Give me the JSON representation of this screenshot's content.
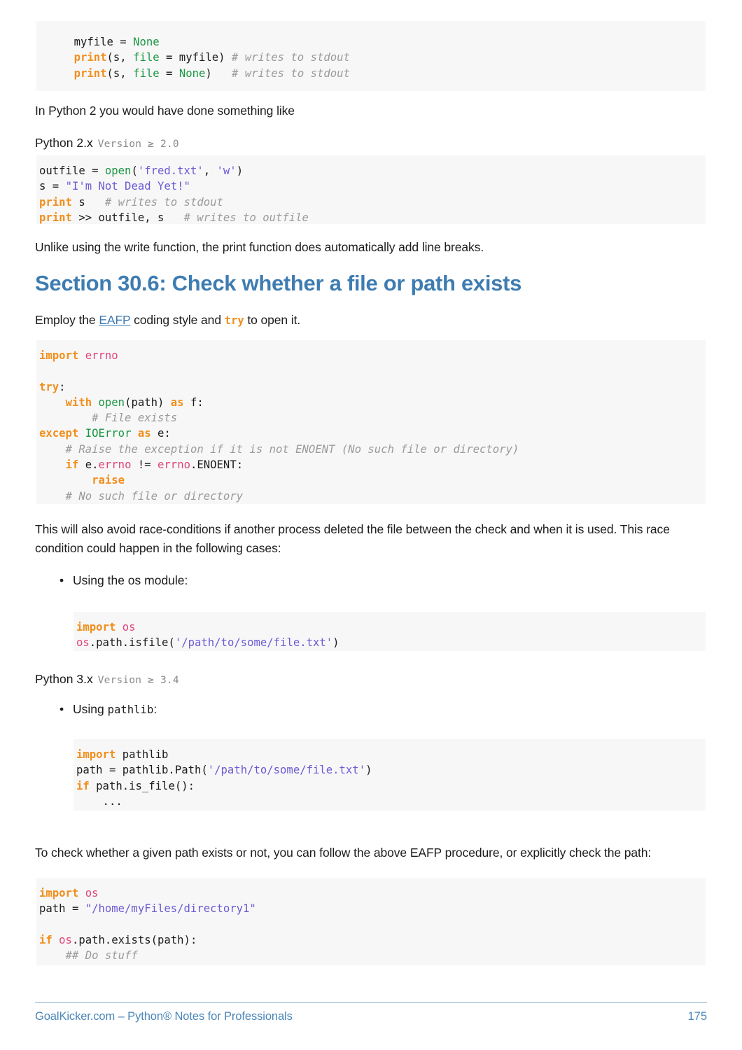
{
  "document": {
    "page_number": "175",
    "footer_text": "GoalKicker.com – Python® Notes for Professionals",
    "accent_color": "#3e7cb1",
    "code_bg_color": "#f7f7f8"
  },
  "code_block_1": {
    "lines": [
      [
        {
          "t": "    ",
          "c": "pl"
        },
        {
          "t": "myfile ",
          "c": "pl"
        },
        {
          "t": "= ",
          "c": "pl"
        },
        {
          "t": "None",
          "c": "bi"
        }
      ],
      [
        {
          "t": "    ",
          "c": "pl"
        },
        {
          "t": "print",
          "c": "kw"
        },
        {
          "t": "(s, ",
          "c": "pl"
        },
        {
          "t": "file",
          "c": "bi"
        },
        {
          "t": " = myfile) ",
          "c": "pl"
        },
        {
          "t": "# writes to stdout",
          "c": "cmt"
        }
      ],
      [
        {
          "t": "    ",
          "c": "pl"
        },
        {
          "t": "print",
          "c": "kw"
        },
        {
          "t": "(s, ",
          "c": "pl"
        },
        {
          "t": "file",
          "c": "bi"
        },
        {
          "t": " = ",
          "c": "pl"
        },
        {
          "t": "None",
          "c": "bi"
        },
        {
          "t": ")   ",
          "c": "pl"
        },
        {
          "t": "# writes to stdout",
          "c": "cmt"
        }
      ]
    ]
  },
  "para_1": "In Python 2 you would have done something like",
  "version_2x": {
    "name": "Python 2.x",
    "version": "Version ≥ 2.0"
  },
  "code_block_2": {
    "lines": [
      [
        {
          "t": "outfile = ",
          "c": "pl"
        },
        {
          "t": "open",
          "c": "bi"
        },
        {
          "t": "(",
          "c": "pl"
        },
        {
          "t": "'fred.txt'",
          "c": "str"
        },
        {
          "t": ", ",
          "c": "pl"
        },
        {
          "t": "'w'",
          "c": "str"
        },
        {
          "t": ")",
          "c": "pl"
        }
      ],
      [
        {
          "t": "s = ",
          "c": "pl"
        },
        {
          "t": "\"I'm Not Dead Yet!\"",
          "c": "str"
        }
      ],
      [
        {
          "t": "print",
          "c": "kw"
        },
        {
          "t": " s   ",
          "c": "pl"
        },
        {
          "t": "# writes to stdout",
          "c": "cmt"
        }
      ],
      [
        {
          "t": "print",
          "c": "kw"
        },
        {
          "t": " >> outfile, s   ",
          "c": "pl"
        },
        {
          "t": "# writes to outfile",
          "c": "cmt"
        }
      ]
    ]
  },
  "para_2": "Unlike using the write function, the print function does automatically add line breaks.",
  "section_heading": "Section 30.6: Check whether a file or path exists",
  "para_3": {
    "before_link": "Employ the ",
    "link": "EAFP",
    "middle": " coding style and ",
    "code": "try",
    "after": " to open it."
  },
  "code_block_3": {
    "lines": [
      [
        {
          "t": "import",
          "c": "kw"
        },
        {
          "t": " ",
          "c": "pl"
        },
        {
          "t": "errno",
          "c": "mod"
        }
      ],
      [
        {
          "t": "",
          "c": "pl"
        }
      ],
      [
        {
          "t": "try",
          "c": "kw"
        },
        {
          "t": ":",
          "c": "pl"
        }
      ],
      [
        {
          "t": "    ",
          "c": "pl"
        },
        {
          "t": "with",
          "c": "kw"
        },
        {
          "t": " ",
          "c": "pl"
        },
        {
          "t": "open",
          "c": "bi"
        },
        {
          "t": "(path) ",
          "c": "pl"
        },
        {
          "t": "as",
          "c": "kw"
        },
        {
          "t": " f:",
          "c": "pl"
        }
      ],
      [
        {
          "t": "        ",
          "c": "pl"
        },
        {
          "t": "# File exists",
          "c": "cmt"
        }
      ],
      [
        {
          "t": "except",
          "c": "kw"
        },
        {
          "t": " ",
          "c": "pl"
        },
        {
          "t": "IOError",
          "c": "bi"
        },
        {
          "t": " ",
          "c": "pl"
        },
        {
          "t": "as",
          "c": "kw"
        },
        {
          "t": " e:",
          "c": "pl"
        }
      ],
      [
        {
          "t": "    ",
          "c": "pl"
        },
        {
          "t": "# Raise the exception if it is not ENOENT (No such file or directory)",
          "c": "cmt"
        }
      ],
      [
        {
          "t": "    ",
          "c": "pl"
        },
        {
          "t": "if",
          "c": "kw"
        },
        {
          "t": " e.",
          "c": "pl"
        },
        {
          "t": "errno",
          "c": "mod"
        },
        {
          "t": " != ",
          "c": "pl"
        },
        {
          "t": "errno",
          "c": "mod"
        },
        {
          "t": ".ENOENT:",
          "c": "pl"
        }
      ],
      [
        {
          "t": "        ",
          "c": "pl"
        },
        {
          "t": "raise",
          "c": "kw"
        }
      ],
      [
        {
          "t": "    ",
          "c": "pl"
        },
        {
          "t": "# No such file or directory",
          "c": "cmt"
        }
      ]
    ]
  },
  "para_4": "This will also avoid race-conditions if another process deleted the file between the check and when it is used. This race condition could happen in the following cases:",
  "bullet_1": {
    "before": "Using the os module:",
    "marker": "•"
  },
  "code_block_4": {
    "lines": [
      [
        {
          "t": "import",
          "c": "kw"
        },
        {
          "t": " ",
          "c": "pl"
        },
        {
          "t": "os",
          "c": "mod"
        }
      ],
      [
        {
          "t": "os",
          "c": "mod"
        },
        {
          "t": ".path.isfile(",
          "c": "pl"
        },
        {
          "t": "'/path/to/some/file.txt'",
          "c": "str"
        },
        {
          "t": ")",
          "c": "pl"
        }
      ]
    ]
  },
  "version_3x": {
    "name": "Python 3.x",
    "version": "Version ≥ 3.4"
  },
  "bullet_2": {
    "marker": "•",
    "prefix": "Using ",
    "code": "pathlib",
    "suffix": ":"
  },
  "code_block_5": {
    "lines": [
      [
        {
          "t": "import",
          "c": "kw"
        },
        {
          "t": " pathlib",
          "c": "pl"
        }
      ],
      [
        {
          "t": "path = pathlib.Path(",
          "c": "pl"
        },
        {
          "t": "'/path/to/some/file.txt'",
          "c": "str"
        },
        {
          "t": ")",
          "c": "pl"
        }
      ],
      [
        {
          "t": "if",
          "c": "kw"
        },
        {
          "t": " path.is_file():",
          "c": "pl"
        }
      ],
      [
        {
          "t": "    ...",
          "c": "pl"
        }
      ]
    ]
  },
  "para_5": "To check whether a given path exists or not, you can follow the above EAFP procedure, or explicitly check the path:",
  "code_block_6": {
    "lines": [
      [
        {
          "t": "import",
          "c": "kw"
        },
        {
          "t": " ",
          "c": "pl"
        },
        {
          "t": "os",
          "c": "mod"
        }
      ],
      [
        {
          "t": "path = ",
          "c": "pl"
        },
        {
          "t": "\"/home/myFiles/directory1\"",
          "c": "str"
        }
      ],
      [
        {
          "t": "",
          "c": "pl"
        }
      ],
      [
        {
          "t": "if",
          "c": "kw"
        },
        {
          "t": " ",
          "c": "pl"
        },
        {
          "t": "os",
          "c": "mod"
        },
        {
          "t": ".path.exists(path):",
          "c": "pl"
        }
      ],
      [
        {
          "t": "    ",
          "c": "pl"
        },
        {
          "t": "## Do stuff",
          "c": "cmt"
        }
      ]
    ]
  }
}
